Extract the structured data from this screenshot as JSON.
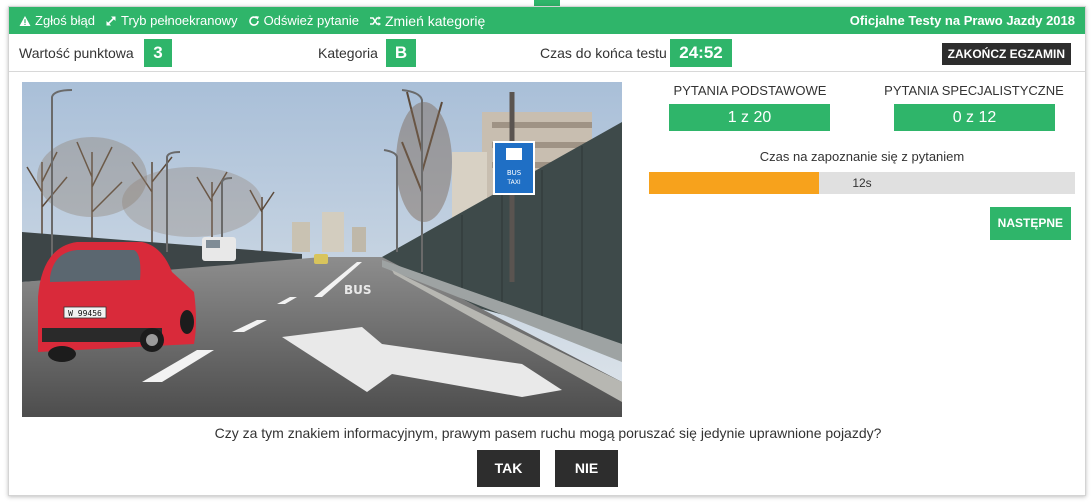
{
  "toolbar": {
    "report_error": "Zgłoś błąd",
    "fullscreen": "Tryb pełnoekranowy",
    "refresh_question": "Odśwież pytanie",
    "change_category": "Zmień kategorię",
    "app_title": "Oficjalne Testy na Prawo Jazdy 2018",
    "icons": [
      "warning-icon",
      "expand-icon",
      "refresh-icon",
      "shuffle-icon"
    ]
  },
  "info": {
    "points_label": "Wartość punktowa",
    "points_value": "3",
    "category_label": "Kategoria",
    "category_value": "B",
    "time_label": "Czas do końca testu",
    "time_value": "24:52",
    "end_exam": "ZAKOŃCZ EGZAMIN"
  },
  "sign": {
    "line1": "BUS",
    "line2": "TAXI"
  },
  "road_marking": "BUS",
  "license_plate": "W 99456",
  "questions": {
    "basic_label": "PYTANIA PODSTAWOWE",
    "basic_value": "1 z 20",
    "special_label": "PYTANIA SPECJALISTYCZNE",
    "special_value": "0 z 12"
  },
  "timer": {
    "label": "Czas na zapoznanie się z pytaniem",
    "text": "12s",
    "fraction_filled": 0.4
  },
  "next_button": "NASTĘPNE",
  "question_text": "Czy za tym znakiem informacyjnym, prawym pasem ruchu mogą poruszać się jedynie uprawnione pojazdy?",
  "answers": {
    "yes": "TAK",
    "no": "NIE"
  },
  "colors": {
    "accent": "#2fb56a",
    "dark_button": "#2d2d2d",
    "timer_fill": "#f7a21c",
    "sign_blue": "#1f6fc5"
  }
}
